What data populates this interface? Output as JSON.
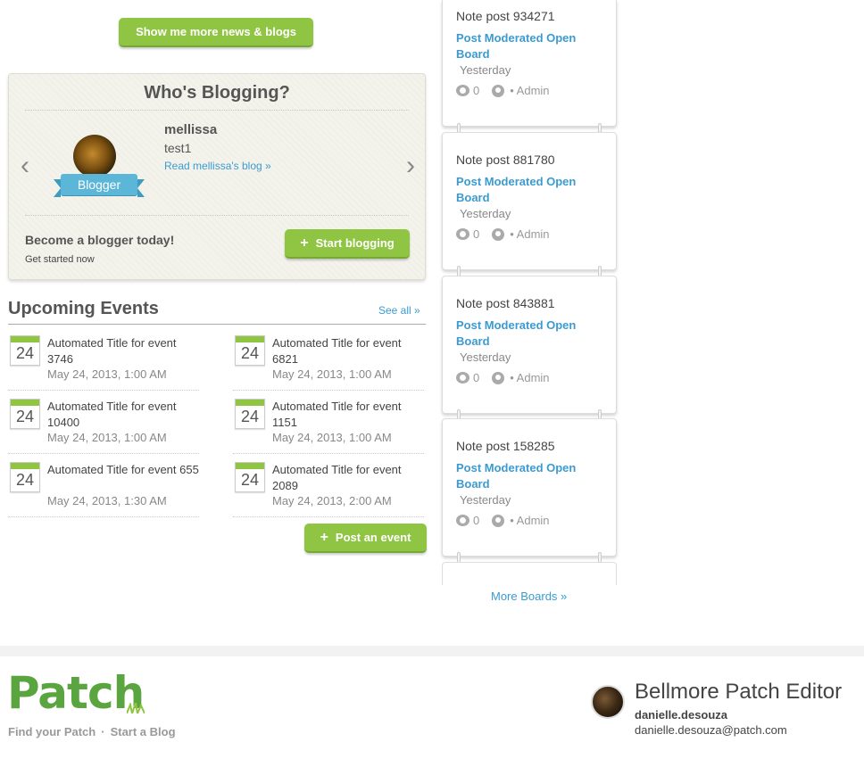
{
  "top_button": {
    "label": "Show me more news & blogs"
  },
  "whos_blogging": {
    "title": "Who's Blogging?",
    "blogger": {
      "name": "mellissa",
      "subtitle": "test1",
      "link": "Read mellissa's blog »",
      "badge": "Blogger"
    },
    "cta_title": "Become a blogger today!",
    "cta_sub": "Get started now",
    "start_button": "Start blogging"
  },
  "events": {
    "heading": "Upcoming Events",
    "see_all": "See all »",
    "items": [
      {
        "day": "24",
        "title": "Automated Title for event 3746",
        "date": "May 24, 2013, 1:00 AM"
      },
      {
        "day": "24",
        "title": "Automated Title for event 6821",
        "date": "May 24, 2013, 1:00 AM"
      },
      {
        "day": "24",
        "title": "Automated Title for event 10400",
        "date": "May 24, 2013, 1:00 AM"
      },
      {
        "day": "24",
        "title": "Automated Title for event 1151",
        "date": "May 24, 2013, 1:00 AM"
      },
      {
        "day": "24",
        "title": "Automated Title for event 655",
        "date": "May 24, 2013, 1:30 AM"
      },
      {
        "day": "24",
        "title": "Automated Title for event 2089",
        "date": "May 24, 2013, 2:00 AM"
      }
    ],
    "post_button": "Post an event"
  },
  "boards": {
    "items": [
      {
        "title": "Note post 934271",
        "board": "Post Moderated Open Board",
        "time": "Yesterday",
        "comments": "0",
        "author": "• Admin"
      },
      {
        "title": "Note post 881780",
        "board": "Post Moderated Open Board",
        "time": "Yesterday",
        "comments": "0",
        "author": "• Admin"
      },
      {
        "title": "Note post 843881",
        "board": "Post Moderated Open Board",
        "time": "Yesterday",
        "comments": "0",
        "author": "• Admin"
      },
      {
        "title": "Note post 158285",
        "board": "Post Moderated Open Board",
        "time": "Yesterday",
        "comments": "0",
        "author": "• Admin"
      }
    ],
    "more": "More Boards »"
  },
  "footer": {
    "logo": "Patch",
    "link1": "Find your Patch",
    "link2": "Start a Blog",
    "editor_title": "Bellmore Patch Editor",
    "editor_user": "danielle.desouza",
    "editor_email": "danielle.desouza@patch.com"
  },
  "colors": {
    "accent_green": "#8fc542",
    "link_blue": "#3b9bd1",
    "logo_green": "#5aa53f"
  }
}
